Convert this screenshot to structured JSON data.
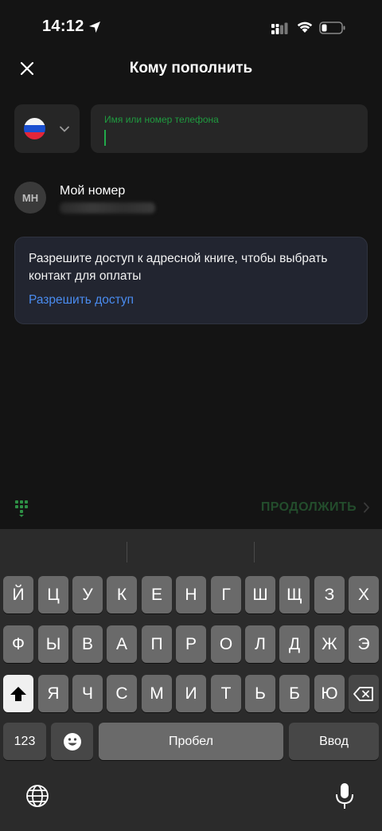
{
  "status_bar": {
    "time": "14:12"
  },
  "header": {
    "title": "Кому пополнить"
  },
  "country_selector": {
    "flag": "ru-flag"
  },
  "search": {
    "label": "Имя или номер телефона",
    "value": ""
  },
  "my_number": {
    "initials": "MH",
    "label": "Мой номер"
  },
  "permission_card": {
    "text": "Разрешите доступ к адресной книге, чтобы выбрать контакт для оплаты",
    "link": "Разрешить доступ"
  },
  "continue_label": "ПРОДОЛЖИТЬ",
  "colors": {
    "accent_green": "#22a94a",
    "link_blue": "#4a8cf0",
    "card_bg": "#222530"
  },
  "keyboard": {
    "row1": [
      "Й",
      "Ц",
      "У",
      "К",
      "Е",
      "Н",
      "Г",
      "Ш",
      "Щ",
      "З",
      "Х"
    ],
    "row2": [
      "Ф",
      "Ы",
      "В",
      "А",
      "П",
      "Р",
      "О",
      "Л",
      "Д",
      "Ж",
      "Э"
    ],
    "row3": [
      "Я",
      "Ч",
      "С",
      "М",
      "И",
      "Т",
      "Ь",
      "Б",
      "Ю"
    ],
    "numbers_label": "123",
    "space_label": "Пробел",
    "return_label": "Ввод"
  }
}
